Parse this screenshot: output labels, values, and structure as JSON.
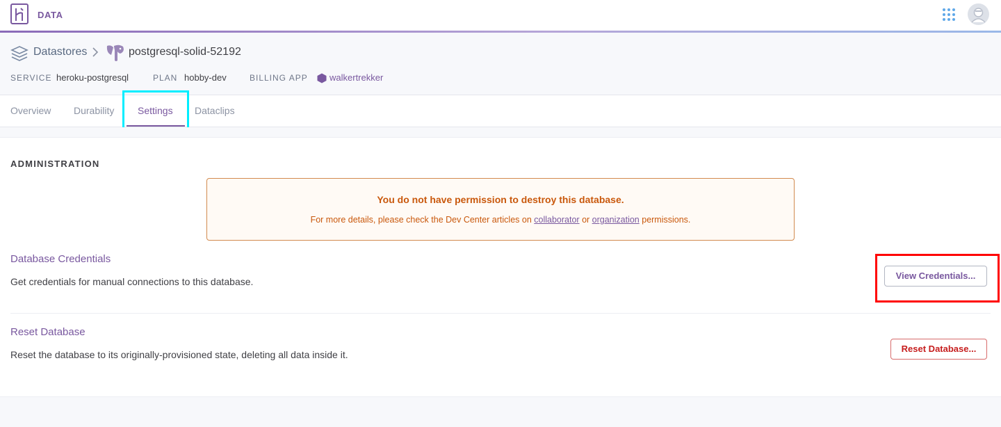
{
  "app": {
    "name": "DATA"
  },
  "breadcrumb": {
    "datastores_label": "Datastores",
    "database_name": "postgresql-solid-52192"
  },
  "meta": {
    "service_label": "SERVICE",
    "service_value": "heroku-postgresql",
    "plan_label": "PLAN",
    "plan_value": "hobby-dev",
    "billing_label": "BILLING APP",
    "billing_value": "walkertrekker"
  },
  "tabs": [
    {
      "label": "Overview"
    },
    {
      "label": "Durability"
    },
    {
      "label": "Settings",
      "active": true
    },
    {
      "label": "Dataclips"
    }
  ],
  "administration": {
    "title": "ADMINISTRATION",
    "warning": {
      "title": "You do not have permission to destroy this database.",
      "text_before": "For more details, please check the Dev Center articles on ",
      "link1": "collaborator",
      "text_middle": " or ",
      "link2": "organization",
      "text_after": " permissions."
    },
    "credentials": {
      "title": "Database Credentials",
      "description": "Get credentials for manual connections to this database.",
      "button": "View Credentials..."
    },
    "reset": {
      "title": "Reset Database",
      "description": "Reset the database to its originally-provisioned state, deleting all data inside it.",
      "button": "Reset Database..."
    }
  },
  "colors": {
    "brand": "#79589f",
    "warning": "#c9580c",
    "danger": "#c61d1d",
    "highlight_tab": "#00eeff",
    "highlight_button": "#ff0000"
  },
  "icons": [
    "heroku-logo-icon",
    "apps-grid-icon",
    "avatar-icon",
    "datastores-stack-icon",
    "chevron-right-icon",
    "postgresql-elephant-icon",
    "hexagon-app-icon"
  ]
}
